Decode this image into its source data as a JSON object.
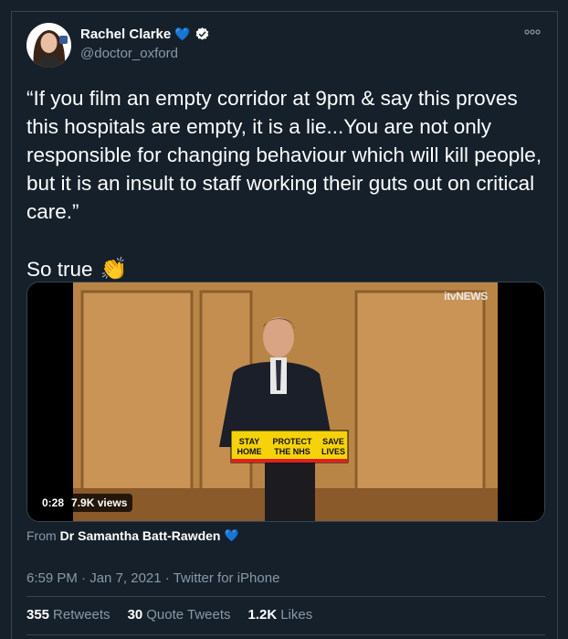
{
  "user": {
    "display_name": "Rachel Clarke",
    "handle": "@doctor_oxford",
    "heart_emoji": "💙"
  },
  "tweet": {
    "text": "“If you film an empty corridor at 9pm & say this proves this hospitals are empty, it is a lie...You are not only responsible for changing behaviour which will kill people, but it is an insult to staff working their guts out on critical care.”",
    "so_true": "So true",
    "clap_emoji": "👏"
  },
  "video": {
    "channel_logo": "itvNEWS",
    "duration": "0:28",
    "views": "7.9K views",
    "podium_sign": [
      "STAY HOME",
      "PROTECT THE NHS",
      "SAVE LIVES"
    ]
  },
  "source": {
    "prefix": "From",
    "name": "Dr Samantha Batt-Rawden",
    "heart_emoji": "💙"
  },
  "meta": {
    "time": "6:59 PM",
    "separator": "·",
    "date": "Jan 7, 2021",
    "client": "Twitter for iPhone"
  },
  "stats": {
    "retweets_count": "355",
    "retweets_label": "Retweets",
    "quotes_count": "30",
    "quotes_label": "Quote Tweets",
    "likes_count": "1.2K",
    "likes_label": "Likes"
  },
  "colors": {
    "background": "#15202b",
    "border": "#38444d",
    "secondary_text": "#8899a6",
    "verified": "#1da1f2"
  }
}
